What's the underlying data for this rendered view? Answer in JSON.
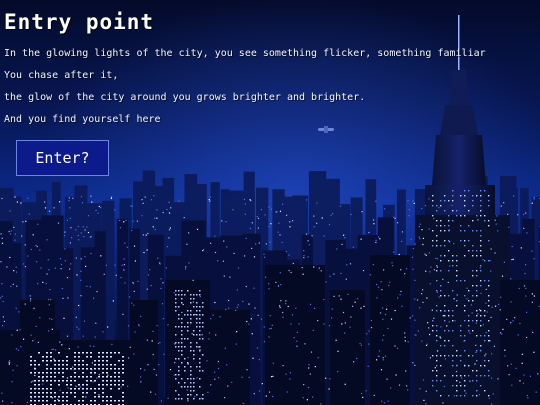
{
  "title": "Entry point",
  "story": [
    "In the glowing lights of the city, you see something flicker, something familiar",
    "You chase after it,",
    "the glow of the city around you grows brighter and brighter.",
    "And you find yourself here"
  ],
  "enter_button": "Enter?",
  "colors": {
    "sky_top": "#061038",
    "sky_mid": "#0a2a8a",
    "button_bg": "#0c1a8c",
    "city_light": "#cfe0ff"
  }
}
